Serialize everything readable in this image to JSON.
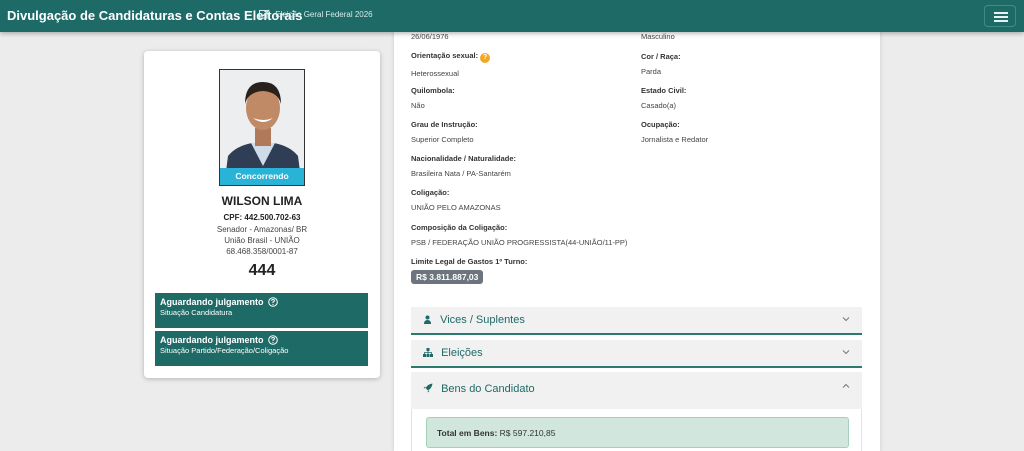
{
  "header": {
    "title": "Divulgação de Candidaturas e Contas Eleitorais",
    "election": "Eleição Geral Federal 2026"
  },
  "candidate": {
    "photo_badge": "Concorrendo",
    "name": "WILSON LIMA",
    "cpf": "CPF: 442.500.702-63",
    "cargo": "Senador - Amazonas/ BR",
    "party": "União Brasil - UNIÃO",
    "cnpj": "68.468.358/0001-87",
    "number": "444",
    "status_candidatura": {
      "title": "Aguardando julgamento",
      "subtitle": "Situação Candidatura"
    },
    "status_partido": {
      "title": "Aguardando julgamento",
      "subtitle": "Situação Partido/Federação/Coligação"
    }
  },
  "details": {
    "birth_date": "26/06/1976",
    "gender": "Masculino",
    "orientacao_label": "Orientação sexual:",
    "orientacao_badge": "?",
    "orientacao_value": "Heterossexual",
    "cor_label": "Cor / Raça:",
    "cor_value": "Parda",
    "quilombola_label": "Quilombola:",
    "quilombola_value": "Não",
    "estado_civil_label": "Estado Civil:",
    "estado_civil_value": "Casado(a)",
    "grau_label": "Grau de Instrução:",
    "grau_value": "Superior Completo",
    "ocupacao_label": "Ocupação:",
    "ocupacao_value": "Jornalista e Redator",
    "nacionalidade_label": "Nacionalidade / Naturalidade:",
    "nacionalidade_value": "Brasileira Nata / PA-Santarém",
    "coligacao_label": "Coligação:",
    "coligacao_value": "UNIÃO PELO AMAZONAS",
    "composicao_label": "Composição da Coligação:",
    "composicao_value": "PSB / FEDERAÇÃO UNIÃO PROGRESSISTA(44-UNIÃO/11-PP)",
    "limite_label": "Limite Legal de Gastos 1º Turno:",
    "limite_value": "R$ 3.811.887,03"
  },
  "accordions": {
    "vices": "Vices / Suplentes",
    "eleicoes": "Eleições",
    "bens": "Bens do Candidato"
  },
  "bens": {
    "total_label": "Total em Bens:",
    "total_value": "R$ 597.210,85"
  },
  "colors": {
    "navbar": "#1e6a67",
    "status_box": "#1e6a67",
    "ribbon": "#29b3d6",
    "orange_badge": "#f5a623",
    "total_box": "#d1e7dd"
  },
  "icons": {
    "edit": "edit-icon",
    "menu": "hamburger-icon",
    "help": "question-circle-icon",
    "vices": "user-icon",
    "eleicoes": "sitemap-icon",
    "bens": "rocket-icon",
    "collapse": "chevron-icon"
  }
}
